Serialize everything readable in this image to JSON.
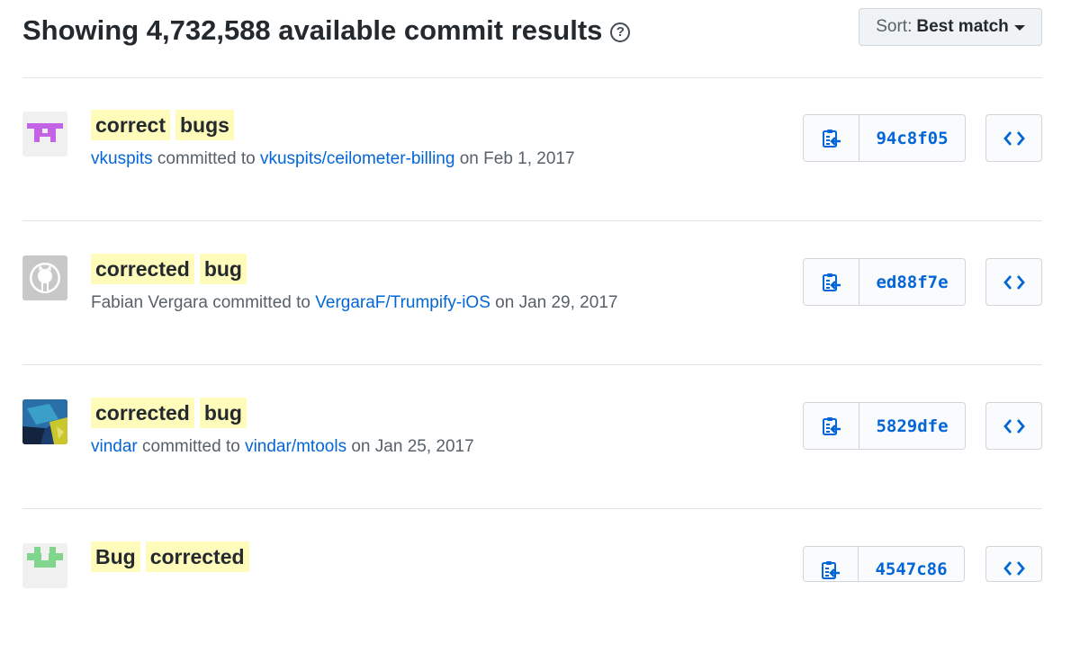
{
  "header": {
    "title": "Showing 4,732,588 available commit results",
    "help_icon": "?",
    "sort_label": "Sort:",
    "sort_value": "Best match"
  },
  "commits": [
    {
      "avatar": "identicon-purple",
      "message_words": [
        "correct",
        "bugs"
      ],
      "author": "vkuspits",
      "author_linked": true,
      "committed_to": "committed to",
      "repo": "vkuspits/ceilometer-billing",
      "on": "on",
      "date": "Feb 1, 2017",
      "sha": "94c8f05"
    },
    {
      "avatar": "github-octocat-gray",
      "message_words": [
        "corrected",
        "bug"
      ],
      "author": "Fabian Vergara",
      "author_linked": false,
      "committed_to": "committed to",
      "repo": "VergaraF/Trumpify-iOS",
      "on": "on",
      "date": "Jan 29, 2017",
      "sha": "ed88f7e"
    },
    {
      "avatar": "photo-avatar-blue",
      "message_words": [
        "corrected",
        "bug"
      ],
      "author": "vindar",
      "author_linked": true,
      "committed_to": "committed to",
      "repo": "vindar/mtools",
      "on": "on",
      "date": "Jan 25, 2017",
      "sha": "5829dfe"
    },
    {
      "avatar": "identicon-green",
      "message_words": [
        "Bug",
        "corrected"
      ],
      "author": "",
      "author_linked": true,
      "committed_to": "",
      "repo": "",
      "on": "",
      "date": "",
      "sha": "4547c86"
    }
  ],
  "icons": {
    "copy": "clippy-icon",
    "browse": "code-icon"
  },
  "colors": {
    "link": "#0366d6",
    "highlight": "#fffbbb",
    "border": "#e1e4e8"
  }
}
